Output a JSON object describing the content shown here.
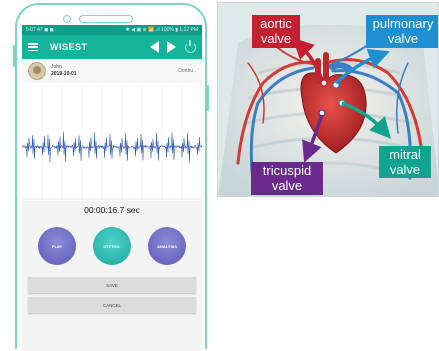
{
  "phone": {
    "statusbar": {
      "left": "5:07 47 ◼ ◼ .",
      "right": "✱ ◀ ▣ ⊕ 📶 .ıl 100% ▮ 1:12 PM"
    },
    "appbar": {
      "title": "WISEST",
      "icons": [
        "menu-icon",
        "back-icon",
        "forward-icon",
        "power-icon"
      ]
    },
    "user": {
      "name": "John",
      "date": "2019-10-01",
      "right_text": "Dorthu.."
    },
    "timer": "00:00:16.7 sec",
    "buttons": {
      "play": "PLAY",
      "steth": "STETHO.",
      "analyse": "ANALYSIS"
    },
    "save": "SAVE",
    "cancel": "CANCEL"
  },
  "heart": {
    "labels": {
      "aortic_1": "aortic",
      "aortic_2": "valve",
      "pulmonary_1": "pulmonary",
      "pulmonary_2": "valve",
      "mitral_1": "mitral",
      "mitral_2": "valve",
      "tricuspid_1": "tricuspid",
      "tricuspid_2": "valve"
    },
    "colors": {
      "aortic": "#c51f32",
      "pulmonary": "#1f8fd2",
      "mitral": "#11a390",
      "tricuspid": "#6a2a8b"
    }
  }
}
